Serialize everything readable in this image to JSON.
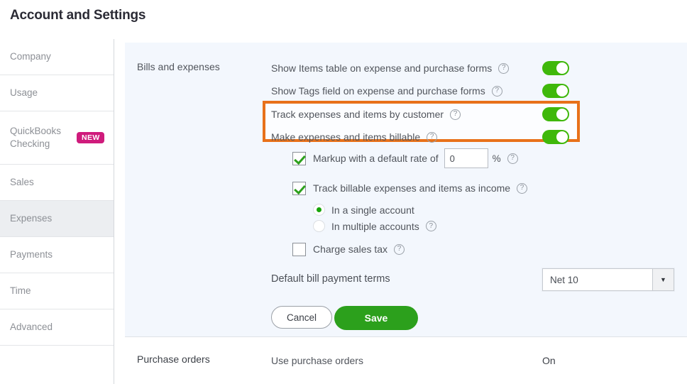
{
  "header": {
    "title": "Account and Settings"
  },
  "sidebar": {
    "items": [
      {
        "label": "Company",
        "active": false,
        "badge": null
      },
      {
        "label": "Usage",
        "active": false,
        "badge": null
      },
      {
        "label": "QuickBooks Checking",
        "active": false,
        "badge": "NEW"
      },
      {
        "label": "Sales",
        "active": false,
        "badge": null
      },
      {
        "label": "Expenses",
        "active": true,
        "badge": null
      },
      {
        "label": "Payments",
        "active": false,
        "badge": null
      },
      {
        "label": "Time",
        "active": false,
        "badge": null
      },
      {
        "label": "Advanced",
        "active": false,
        "badge": null
      }
    ]
  },
  "main": {
    "bills": {
      "section_label": "Bills and expenses",
      "toggles": [
        {
          "label": "Show Items table on expense and purchase forms",
          "state": "on",
          "help": "?"
        },
        {
          "label": "Show Tags field on expense and purchase forms",
          "state": "on",
          "help": "?"
        },
        {
          "label": "Track expenses and items by customer",
          "state": "on",
          "help": "?"
        },
        {
          "label": "Make expenses and items billable",
          "state": "on",
          "help": "?"
        }
      ],
      "markup": {
        "label": "Markup with a default rate of",
        "checked": true,
        "value": "0",
        "placeholder": "0",
        "suffix": "%",
        "help": "?"
      },
      "track_income": {
        "label": "Track billable expenses and items as income",
        "checked": true,
        "help": "?"
      },
      "account_options": [
        {
          "label": "In a single account",
          "selected": true,
          "help": null
        },
        {
          "label": "In multiple accounts",
          "selected": false,
          "help": "?"
        }
      ],
      "charge_tax": {
        "label": "Charge sales tax",
        "checked": false,
        "help": "?"
      },
      "terms": {
        "label": "Default bill payment terms",
        "selected": "Net 10",
        "arrow": "▼"
      },
      "cancel_label": "Cancel",
      "save_label": "Save"
    },
    "purchase_orders": {
      "section_label": "Purchase orders",
      "row_label": "Use purchase orders",
      "value": "On"
    }
  },
  "colors": {
    "toggle_on": "#3fb80a",
    "save_green": "#2ca01c",
    "badge_pink": "#cf1b7c",
    "highlight_orange": "#e8711a",
    "panel_bg": "#f3f7fd"
  }
}
